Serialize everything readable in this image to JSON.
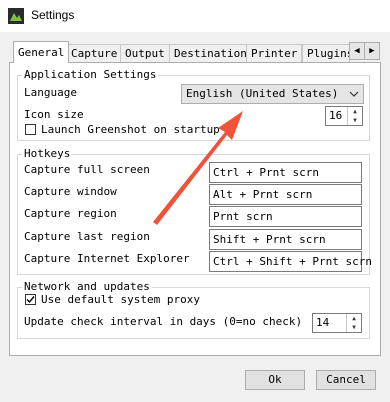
{
  "window": {
    "title": "Settings"
  },
  "tabs": [
    "General",
    "Capture",
    "Output",
    "Destination",
    "Printer",
    "Plugins"
  ],
  "application_settings": {
    "legend": "Application Settings",
    "language_label": "Language",
    "language_value": "English (United States)",
    "icon_size_label": "Icon size",
    "icon_size_value": "16",
    "launch_label": "Launch Greenshot on startup"
  },
  "hotkeys": {
    "legend": "Hotkeys",
    "items": [
      {
        "label": "Capture full screen",
        "value": "Ctrl + Prnt scrn"
      },
      {
        "label": "Capture window",
        "value": "Alt + Prnt scrn"
      },
      {
        "label": "Capture region",
        "value": "Prnt scrn"
      },
      {
        "label": "Capture last region",
        "value": "Shift + Prnt scrn"
      },
      {
        "label": "Capture Internet Explorer",
        "value": "Ctrl + Shift + Prnt scrn"
      }
    ]
  },
  "network": {
    "legend": "Network and updates",
    "proxy_label": "Use default system proxy",
    "proxy_checked": true,
    "update_label": "Update check interval in days (0=no check)",
    "update_value": "14"
  },
  "buttons": {
    "ok": "Ok",
    "cancel": "Cancel"
  },
  "colors": {
    "annotation_arrow": "#f0523a"
  }
}
